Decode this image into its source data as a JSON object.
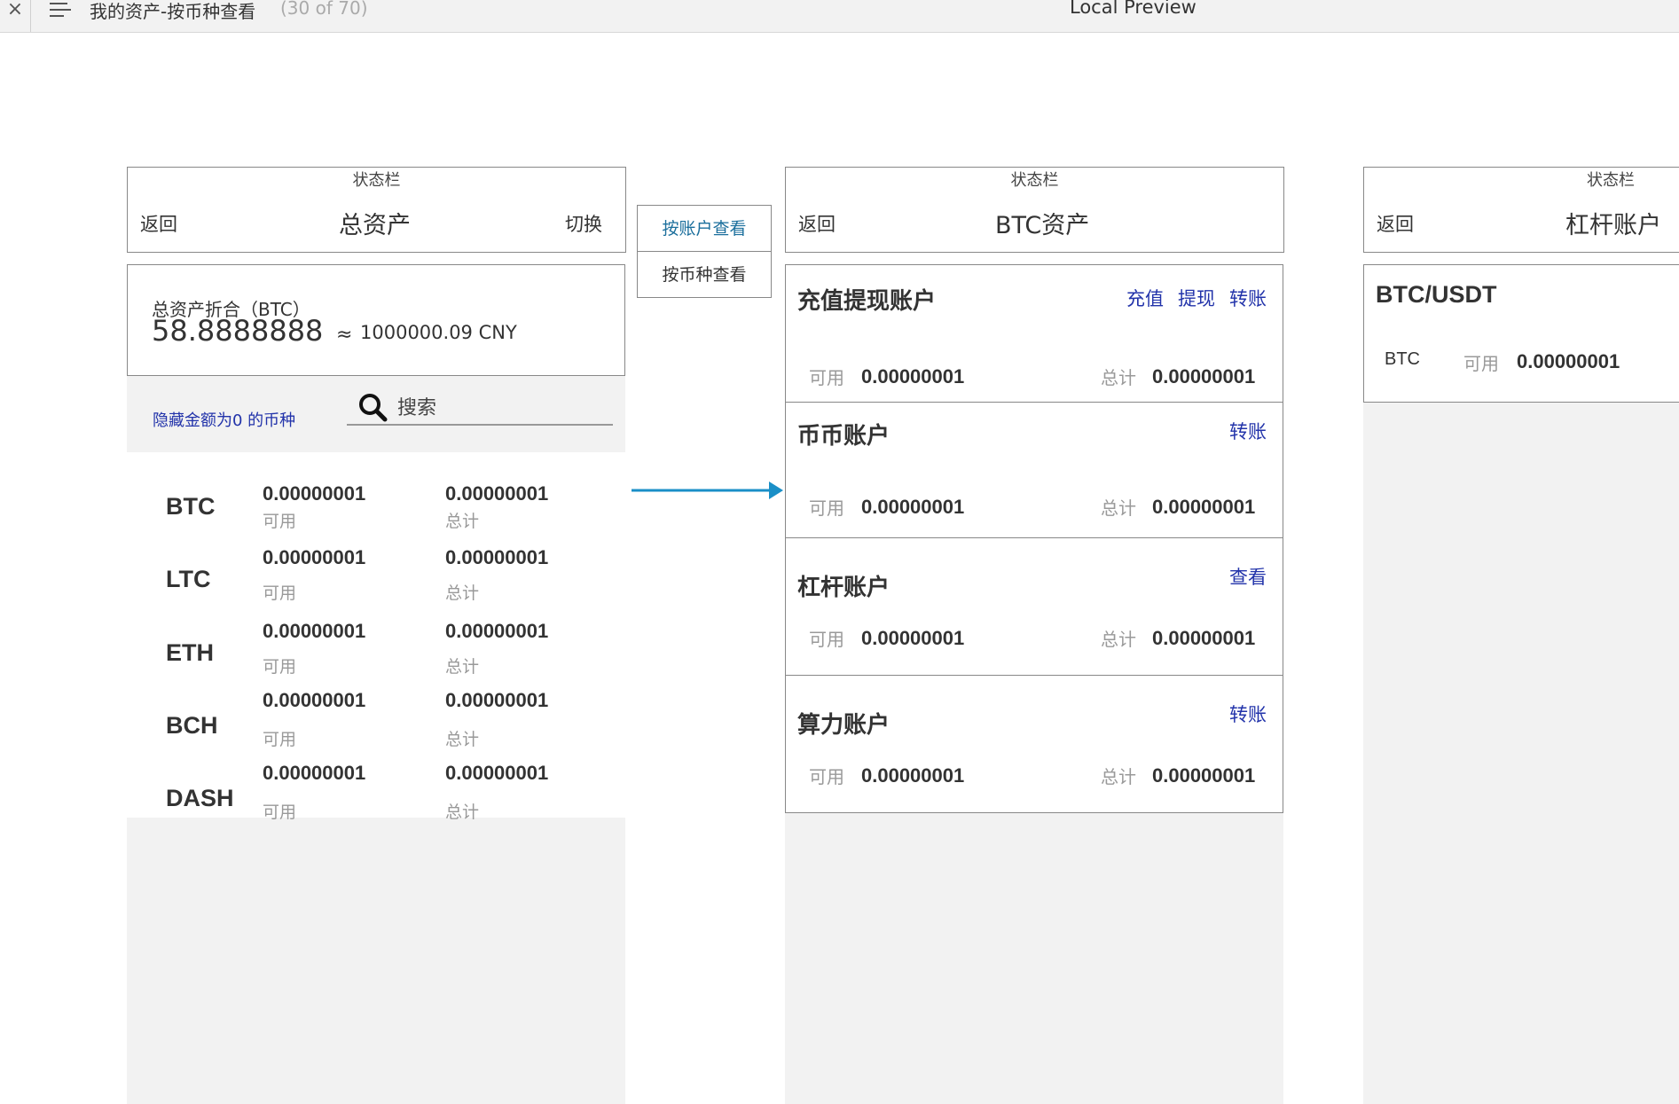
{
  "topbar": {
    "close_glyph": "×",
    "page_title": "我的资产-按币种查看",
    "page_counter": "(30 of 70)",
    "preview_label": "Local Preview"
  },
  "left_screen": {
    "statusbar": "状态栏",
    "nav": {
      "back": "返回",
      "title": "总资产",
      "right": "切换"
    },
    "total": {
      "label": "总资产折合（BTC）",
      "value": "58.8888888",
      "approx": "≈",
      "cny": "1000000.09 CNY"
    },
    "hide_zero_label": "隐藏金额为0 的币种",
    "search_placeholder": "搜索",
    "coins": [
      {
        "symbol": "BTC",
        "available": "0.00000001",
        "available_label": "可用",
        "total": "0.00000001",
        "total_label": "总计"
      },
      {
        "symbol": "LTC",
        "available": "0.00000001",
        "available_label": "可用",
        "total": "0.00000001",
        "total_label": "总计"
      },
      {
        "symbol": "ETH",
        "available": "0.00000001",
        "available_label": "可用",
        "total": "0.00000001",
        "total_label": "总计"
      },
      {
        "symbol": "BCH",
        "available": "0.00000001",
        "available_label": "可用",
        "total": "0.00000001",
        "total_label": "总计"
      },
      {
        "symbol": "DASH",
        "available": "0.00000001",
        "available_label": "可用",
        "total": "0.00000001",
        "total_label": "总计"
      }
    ]
  },
  "toggle": {
    "by_account": "按账户查看",
    "by_coin": "按币种查看",
    "active": "by_account",
    "active_color": "#1a6e9c"
  },
  "arrow": {
    "color": "#1a8fc7"
  },
  "middle_screen": {
    "statusbar": "状态栏",
    "nav": {
      "back": "返回",
      "title": "BTC资产"
    },
    "accounts": [
      {
        "title": "充值提现账户",
        "actions": [
          "充值",
          "提现",
          "转账"
        ],
        "available_label": "可用",
        "available": "0.00000001",
        "total_label": "总计",
        "total": "0.00000001"
      },
      {
        "title": "币币账户",
        "actions": [
          "转账"
        ],
        "available_label": "可用",
        "available": "0.00000001",
        "total_label": "总计",
        "total": "0.00000001"
      },
      {
        "title": "杠杆账户",
        "actions": [
          "查看"
        ],
        "available_label": "可用",
        "available": "0.00000001",
        "total_label": "总计",
        "total": "0.00000001"
      },
      {
        "title": "算力账户",
        "actions": [
          "转账"
        ],
        "available_label": "可用",
        "available": "0.00000001",
        "total_label": "总计",
        "total": "0.00000001"
      }
    ]
  },
  "right_screen": {
    "statusbar": "状态栏",
    "nav": {
      "back": "返回",
      "title": "杠杆账户"
    },
    "pair": {
      "title": "BTC/USDT",
      "coin": "BTC",
      "available_label": "可用",
      "available": "0.00000001"
    }
  },
  "colors": {
    "link": "#2233aa",
    "panel_gray": "#f2f2f2",
    "border": "#888888"
  }
}
